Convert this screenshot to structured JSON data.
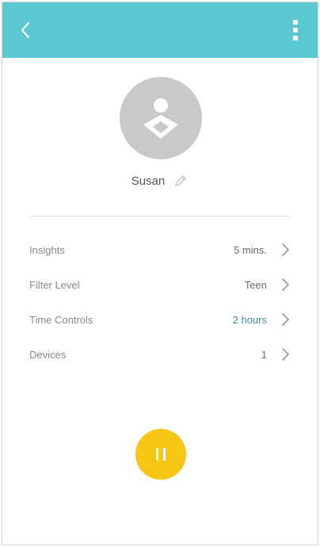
{
  "header": {
    "bg_color": "#5cc9d2",
    "back_icon": "chevron-left-icon",
    "menu_icon": "more-vertical-icon"
  },
  "profile": {
    "name": "Susan",
    "avatar_icon": "person-icon",
    "edit_icon": "pencil-icon"
  },
  "rows": [
    {
      "label": "Insights",
      "value": "5 mins."
    },
    {
      "label": "Filter Level",
      "value": "Teen"
    },
    {
      "label": "Time Controls",
      "value": "2 hours",
      "accent": "#4a8fa0"
    },
    {
      "label": "Devices",
      "value": "1"
    }
  ],
  "pause": {
    "icon": "pause-icon",
    "color": "#f7c614"
  }
}
